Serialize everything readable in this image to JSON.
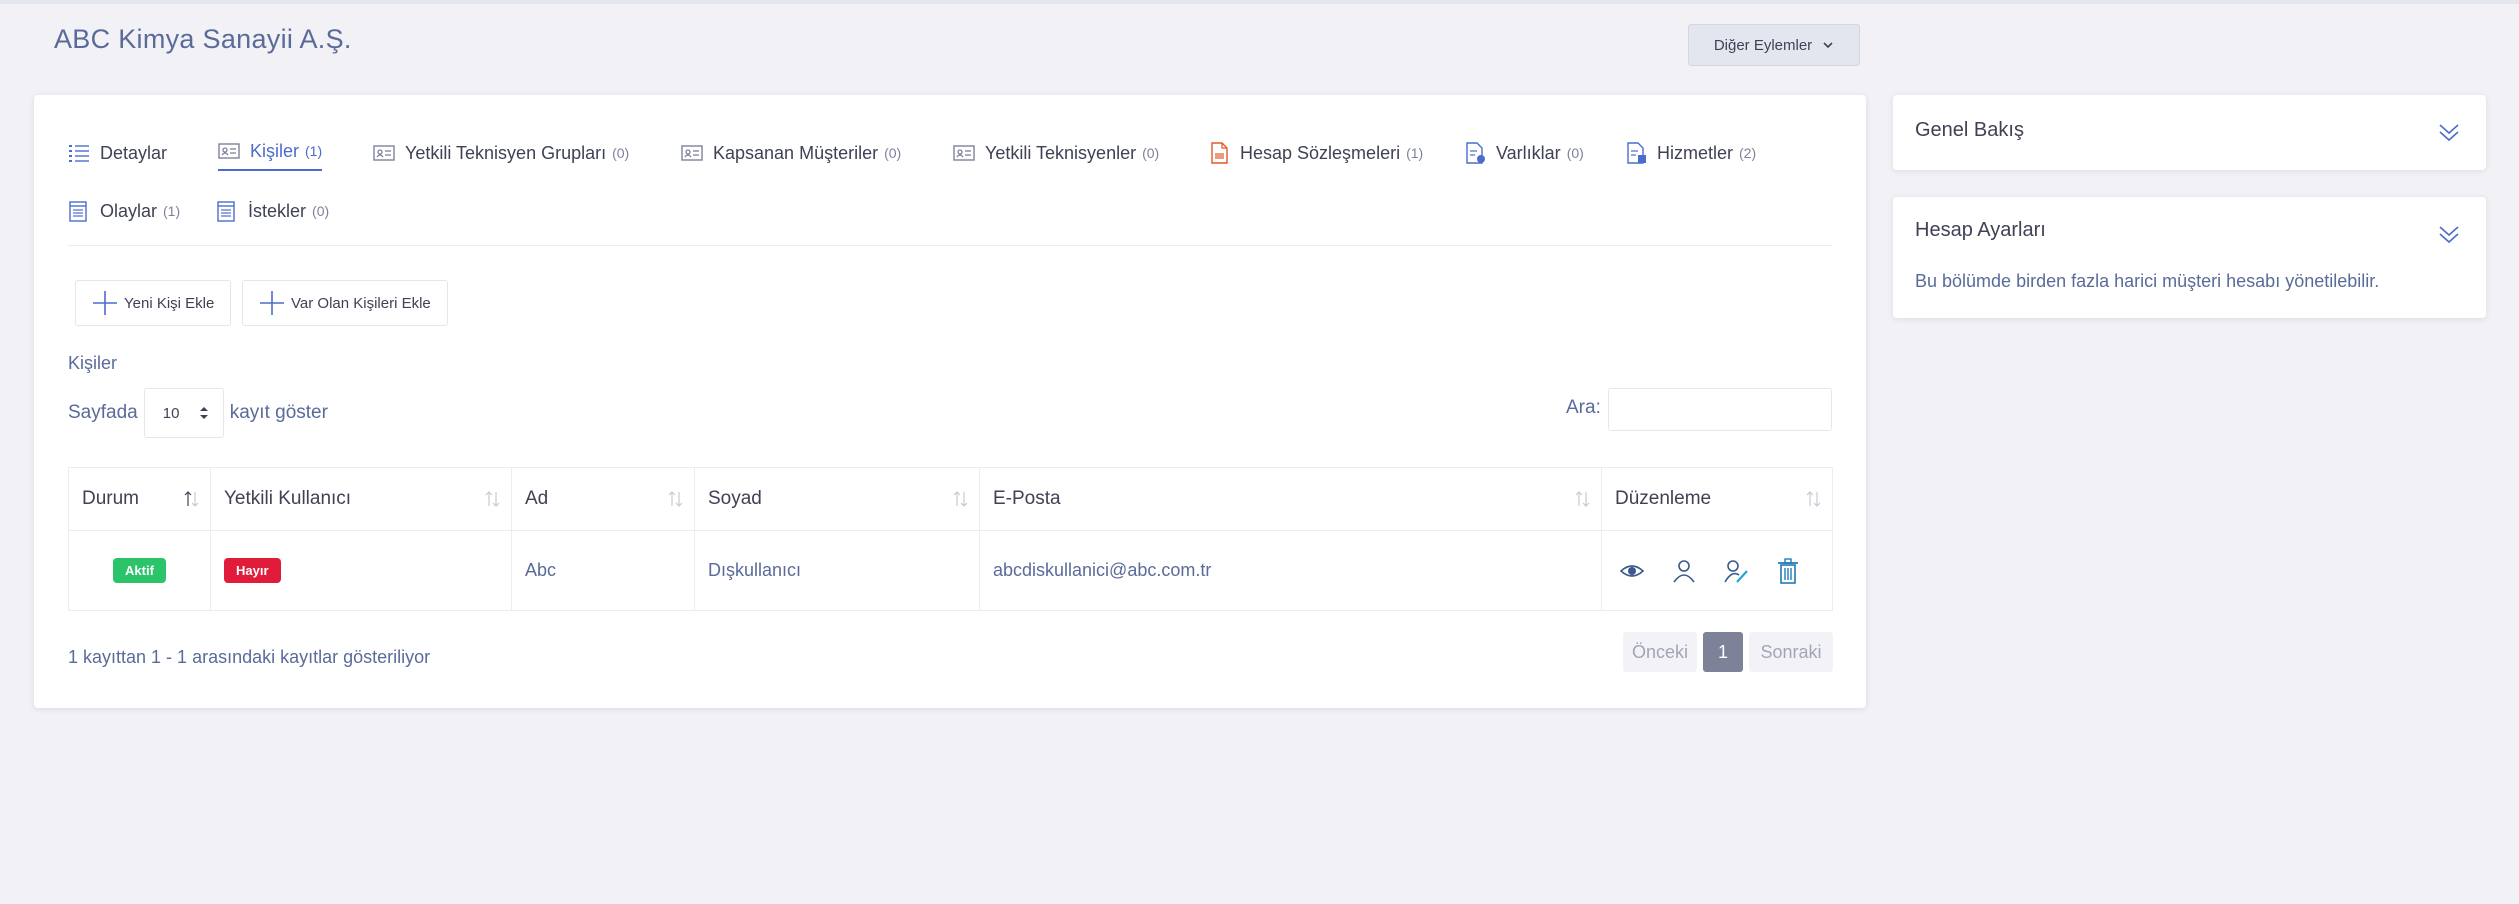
{
  "page": {
    "title": "ABC Kimya Sanayii A.Ş.",
    "other_actions_label": "Diğer Eylemler"
  },
  "tabs": [
    {
      "label": "Detaylar",
      "count": "",
      "icon": "list-icon"
    },
    {
      "label": "Kişiler",
      "count": "(1)",
      "icon": "contact-card-icon"
    },
    {
      "label": "Yetkili Teknisyen Grupları",
      "count": "(0)",
      "icon": "contact-card-icon"
    },
    {
      "label": "Kapsanan Müşteriler",
      "count": "(0)",
      "icon": "contact-card-icon"
    },
    {
      "label": "Yetkili Teknisyenler",
      "count": "(0)",
      "icon": "contact-card-icon"
    },
    {
      "label": "Hesap Sözleşmeleri",
      "count": "(1)",
      "icon": "contract-document-icon"
    },
    {
      "label": "Varlıklar",
      "count": "(0)",
      "icon": "asset-document-icon"
    },
    {
      "label": "Hizmetler",
      "count": "(2)",
      "icon": "service-document-icon"
    },
    {
      "label": "Olaylar",
      "count": "(1)",
      "icon": "calendar-sheet-icon"
    },
    {
      "label": "İstekler",
      "count": "(0)",
      "icon": "calendar-sheet-icon"
    }
  ],
  "buttons": {
    "new_contact": "Yeni Kişi Ekle",
    "add_existing": "Var Olan Kişileri Ekle"
  },
  "section_title": "Kişiler",
  "length_menu": {
    "prefix": "Sayfada",
    "value": "10",
    "suffix": "kayıt göster"
  },
  "search": {
    "label": "Ara:",
    "value": ""
  },
  "table": {
    "columns": [
      "Durum",
      "Yetkili Kullanıcı",
      "Ad",
      "Soyad",
      "E-Posta",
      "Düzenleme"
    ],
    "rows": [
      {
        "status": "Aktif",
        "authorized": "Hayır",
        "first_name": "Abc",
        "last_name": "Dışkullanıcı",
        "email": "abcdiskullanici@abc.com.tr",
        "actions": [
          "eye-icon",
          "user-icon",
          "user-edit-icon",
          "trash-icon"
        ]
      }
    ]
  },
  "info": "1 kayıttan 1 - 1 arasındaki kayıtlar gösteriliyor",
  "pagination": {
    "prev": "Önceki",
    "current": "1",
    "next": "Sonraki"
  },
  "side": {
    "overview_title": "Genel Bakış",
    "settings_title": "Hesap Ayarları",
    "settings_desc": "Bu bölümde birden fazla harici müşteri hesabı yönetilebilir."
  },
  "colors": {
    "accent": "#4c6ccc",
    "active_badge": "#2bc46a",
    "negative_badge": "#e01c3a",
    "doc_icon_accent": "#e0592a"
  }
}
